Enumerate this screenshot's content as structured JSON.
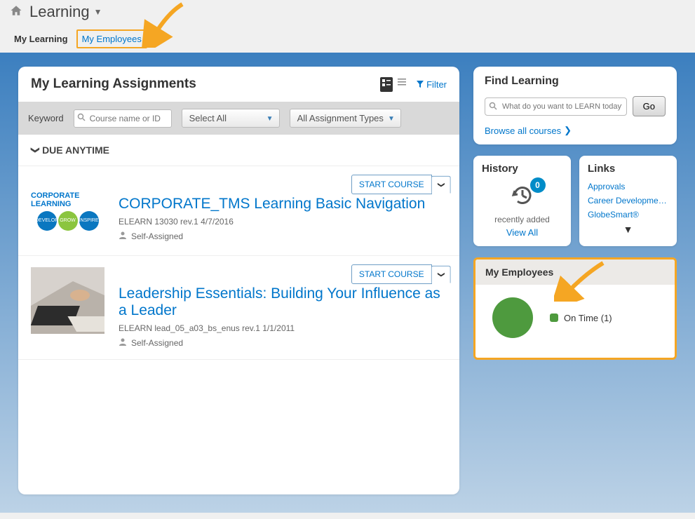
{
  "header": {
    "title": "Learning"
  },
  "tabs": {
    "my_learning": "My Learning",
    "my_employees": "My Employees"
  },
  "assignments_panel": {
    "title": "My Learning Assignments",
    "filter_label": "Filter",
    "keyword_label": "Keyword",
    "keyword_placeholder": "Course name or ID",
    "select_all": "Select All",
    "assignment_types": "All Assignment Types",
    "due_section": "DUE ANYTIME",
    "thumb_corp_text": "CORPORATE LEARNING",
    "items": [
      {
        "title": "CORPORATE_TMS Learning Basic Navigation",
        "meta": "ELEARN 13030 rev.1 4/7/2016",
        "assigned": "Self-Assigned",
        "action": "START COURSE"
      },
      {
        "title": "Leadership Essentials: Building Your Influence as a Leader",
        "meta": "ELEARN lead_05_a03_bs_enus rev.1 1/1/2011",
        "assigned": "Self-Assigned",
        "action": "START COURSE"
      }
    ]
  },
  "find_panel": {
    "title": "Find Learning",
    "placeholder": "What do you want to LEARN today?",
    "go": "Go",
    "browse": "Browse all courses"
  },
  "history_panel": {
    "title": "History",
    "badge": "0",
    "text": "recently added",
    "view_all": "View All"
  },
  "links_panel": {
    "title": "Links",
    "items": [
      "Approvals",
      "Career Developmen...",
      "GlobeSmart®"
    ]
  },
  "employees_panel": {
    "title": "My Employees",
    "legend": "On Time (1)"
  },
  "chart_data": {
    "type": "pie",
    "categories": [
      "On Time"
    ],
    "values": [
      1
    ],
    "title": "My Employees",
    "colors": [
      "#4e9a3e"
    ]
  }
}
